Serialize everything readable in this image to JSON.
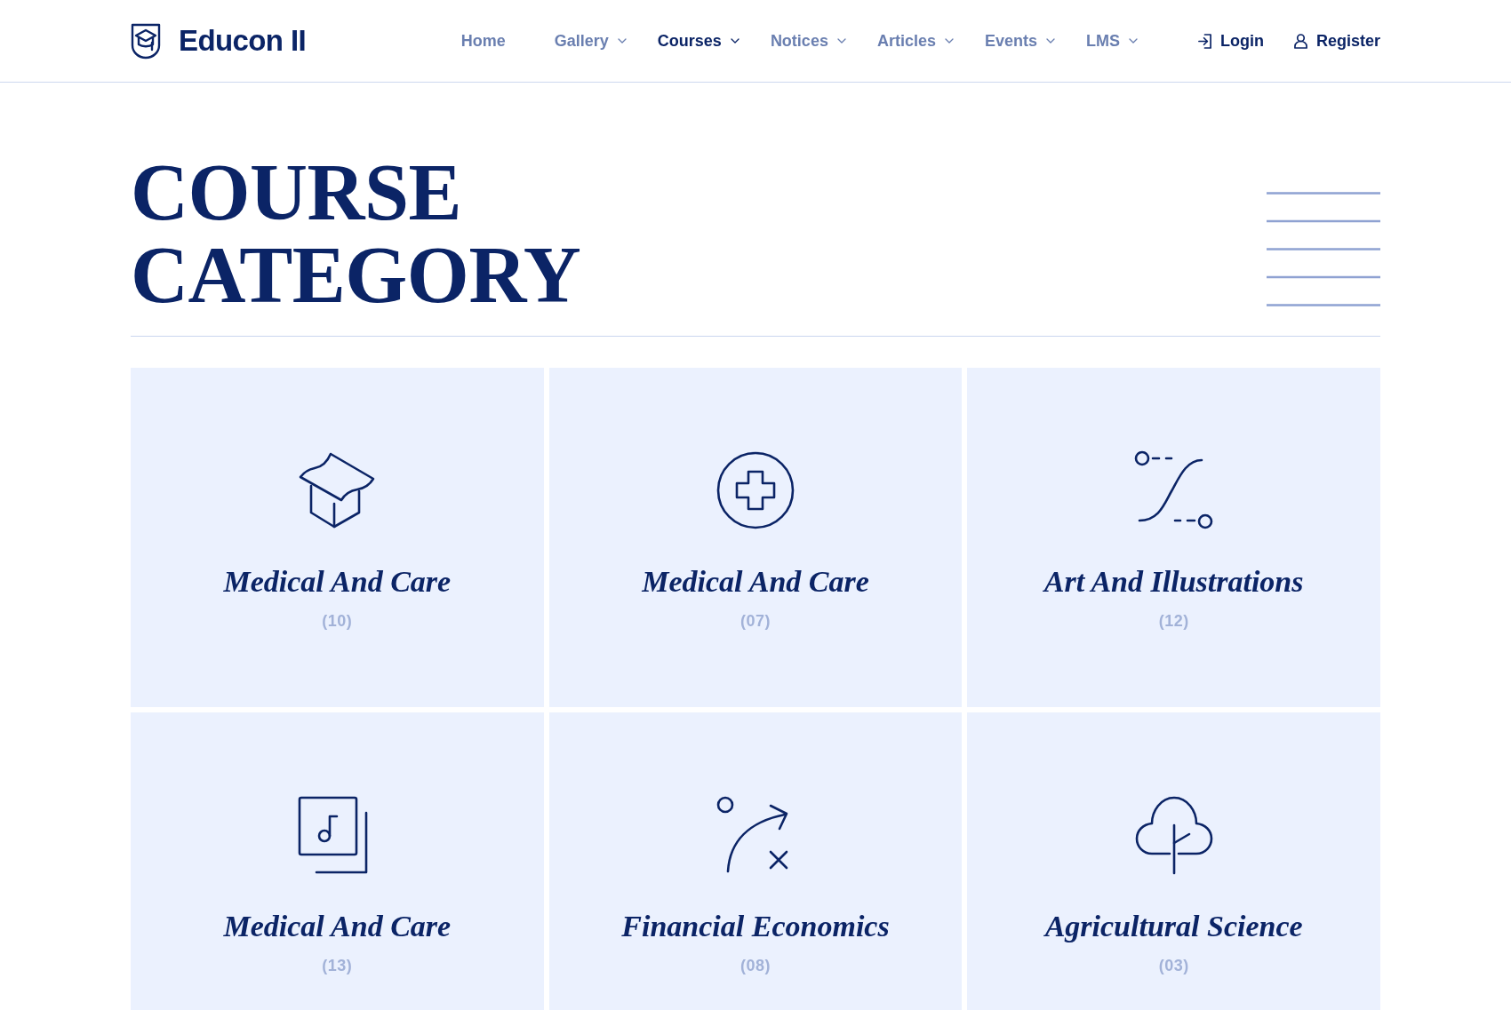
{
  "header": {
    "logo": {
      "text": "Educon II"
    },
    "nav": [
      {
        "label": "Home",
        "dropdown": false,
        "selected": false
      },
      {
        "label": "Gallery",
        "dropdown": true,
        "selected": false
      },
      {
        "label": "Courses",
        "dropdown": true,
        "selected": true
      },
      {
        "label": "Notices",
        "dropdown": true,
        "selected": false
      },
      {
        "label": "Articles",
        "dropdown": true,
        "selected": false
      },
      {
        "label": "Events",
        "dropdown": true,
        "selected": false
      },
      {
        "label": "LMS",
        "dropdown": true,
        "selected": false
      }
    ],
    "actions": [
      {
        "label": "Login",
        "kind": "login"
      },
      {
        "label": "Register",
        "kind": "register"
      }
    ]
  },
  "page_title": "COURSE CATEGORY",
  "categories": [
    {
      "title": "Medical And Care",
      "count": "(10)",
      "kind": "cap"
    },
    {
      "title": "Medical And Care",
      "count": "(07)",
      "kind": "cross"
    },
    {
      "title": "Art And Illustrations",
      "count": "(12)",
      "kind": "curve"
    },
    {
      "title": "Medical And Care",
      "count": "(13)",
      "kind": "music"
    },
    {
      "title": "Financial Economics",
      "count": "(08)",
      "kind": "play"
    },
    {
      "title": "Agricultural Science",
      "count": "(03)",
      "kind": "tree"
    }
  ]
}
